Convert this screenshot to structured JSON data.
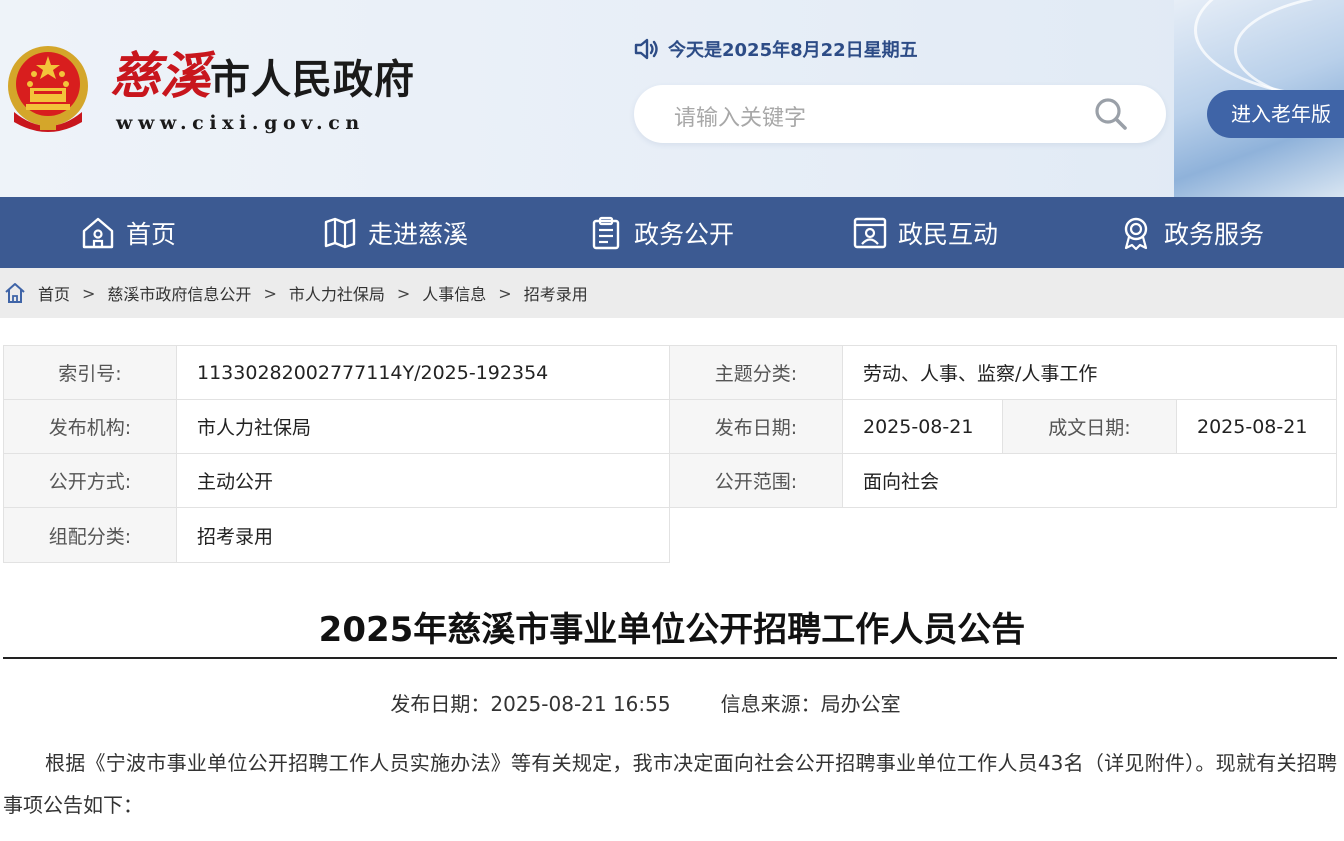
{
  "header": {
    "site_name_red": "慈溪",
    "site_name_rest": "市人民政府",
    "site_url": "www.cixi.gov.cn",
    "date_text": "今天是2025年8月22日星期五",
    "search_placeholder": "请输入关键字",
    "elder_button": "进入老年版"
  },
  "nav": {
    "items": [
      {
        "label": "首页",
        "icon": "home-icon"
      },
      {
        "label": "走进慈溪",
        "icon": "map-icon"
      },
      {
        "label": "政务公开",
        "icon": "clipboard-icon"
      },
      {
        "label": "政民互动",
        "icon": "user-card-icon"
      },
      {
        "label": "政务服务",
        "icon": "award-icon"
      }
    ]
  },
  "breadcrumb": [
    "首页",
    "慈溪市政府信息公开",
    "市人力社保局",
    "人事信息",
    "招考录用"
  ],
  "meta": {
    "index_label": "索引号:",
    "index_value": "11330282002777114Y/2025-192354",
    "topic_label": "主题分类:",
    "topic_value": "劳动、人事、监察/人事工作",
    "org_label": "发布机构:",
    "org_value": "市人力社保局",
    "pubdate_label": "发布日期:",
    "pubdate_value": "2025-08-21",
    "docdate_label": "成文日期:",
    "docdate_value": "2025-08-21",
    "mode_label": "公开方式:",
    "mode_value": "主动公开",
    "scope_label": "公开范围:",
    "scope_value": "面向社会",
    "group_label": "组配分类:",
    "group_value": "招考录用"
  },
  "article": {
    "title": "2025年慈溪市事业单位公开招聘工作人员公告",
    "date": "发布日期：2025-08-21 16:55",
    "source": "信息来源：局办公室",
    "paragraph": "根据《宁波市事业单位公开招聘工作人员实施办法》等有关规定，我市决定面向社会公开招聘事业单位工作人员43名（详见附件）。现就有关招聘事项公告如下："
  },
  "colors": {
    "nav_bg": "#3c5a92",
    "elder_button_bg": "#3f64a7",
    "brand_red": "#c8161d",
    "date_text": "#2d4c86"
  }
}
